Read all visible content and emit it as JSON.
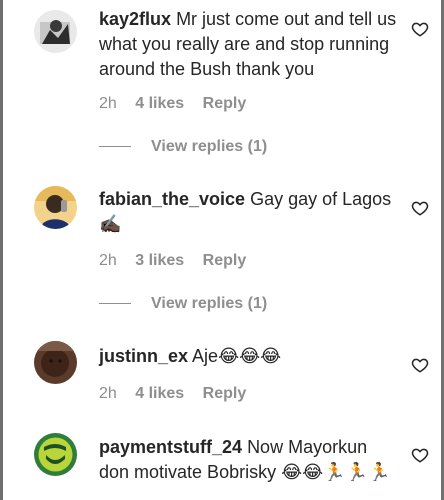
{
  "comments": [
    {
      "username": "kay2flux",
      "text": "Mr just come out and tell us what you really are and stop running around the Bush thank you",
      "time": "2h",
      "likes": "4 likes",
      "reply": "Reply",
      "view_replies": "View replies (1)"
    },
    {
      "username": "fabian_the_voice",
      "text": "Gay gay of Lagos ✍🏿",
      "time": "2h",
      "likes": "3 likes",
      "reply": "Reply",
      "view_replies": "View replies (1)"
    },
    {
      "username": "justinn_ex",
      "text": "Aje😂😂😂",
      "time": "2h",
      "likes": "4 likes",
      "reply": "Reply"
    },
    {
      "username": "paymentstuff_24",
      "text": "Now Mayorkun don motivate Bobrisky 😂😂🏃🏃🏃"
    }
  ],
  "icons": {
    "like": "heart-outline-icon"
  },
  "colors": {
    "text": "#262626",
    "secondary": "#8e8e8e"
  }
}
